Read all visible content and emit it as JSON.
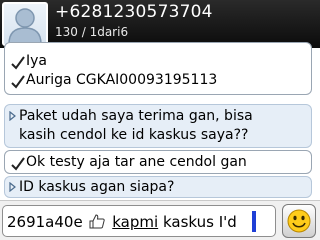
{
  "header": {
    "contact_number": "+6281230573704",
    "message_counter": "130 / 1dari6"
  },
  "messages": [
    {
      "direction": "sent",
      "lines": [
        "Iya",
        "Auriga CGKAI00093195113"
      ]
    },
    {
      "direction": "received",
      "lines": [
        "Paket udah saya terima gan, bisa",
        "kasih cendol ke id kaskus saya??"
      ]
    },
    {
      "direction": "sent",
      "lines": [
        "Ok testy aja tar ane cendol gan"
      ]
    },
    {
      "direction": "received",
      "lines": [
        "ID kaskus agan siapa?"
      ]
    }
  ],
  "compose": {
    "text_before_icon": "2691a40e",
    "text_underlined": "kapmi",
    "text_after": "kaskus I'd",
    "icon": "thumbs-up-icon",
    "emoticon_button_icon": "smiley-icon"
  },
  "colors": {
    "header_bg": "#111111",
    "received_bubble_bg": "#e6eef7",
    "cursor": "#1f3fd6"
  }
}
